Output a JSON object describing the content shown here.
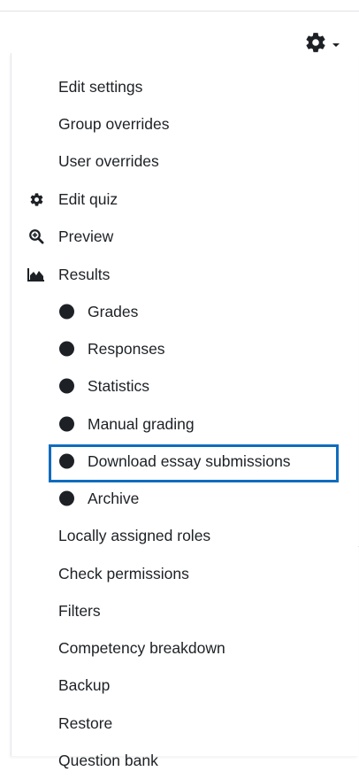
{
  "menu": {
    "gear_icon": "gear-icon",
    "items": [
      {
        "label": "Edit settings"
      },
      {
        "label": "Group overrides"
      },
      {
        "label": "User overrides"
      },
      {
        "label": "Edit quiz",
        "icon": "gear-icon"
      },
      {
        "label": "Preview",
        "icon": "magnify-icon"
      },
      {
        "label": "Results",
        "icon": "area-chart-icon"
      },
      {
        "label": "Grades"
      },
      {
        "label": "Responses"
      },
      {
        "label": "Statistics"
      },
      {
        "label": "Manual grading"
      },
      {
        "label": "Download essay submissions",
        "highlighted": true
      },
      {
        "label": "Archive"
      },
      {
        "label": "Locally assigned roles"
      },
      {
        "label": "Check permissions"
      },
      {
        "label": "Filters"
      },
      {
        "label": "Competency breakdown"
      },
      {
        "label": "Backup"
      },
      {
        "label": "Restore"
      },
      {
        "label": "Question bank"
      }
    ]
  },
  "colors": {
    "text": "#1d2125",
    "highlight_border": "#0f6cbf"
  }
}
